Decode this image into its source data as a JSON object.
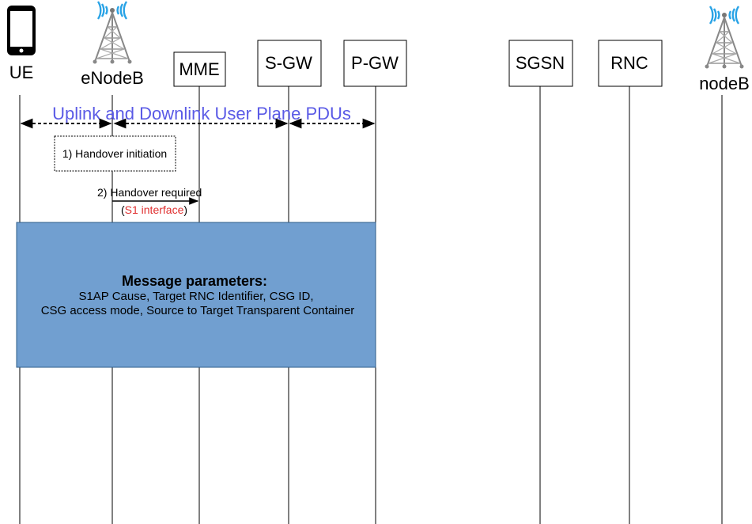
{
  "entities": {
    "ue": "UE",
    "enodeb": "eNodeB",
    "mme": "MME",
    "sgw": "S-GW",
    "pgw": "P-GW",
    "sgsn": "SGSN",
    "rnc": "RNC",
    "nodeb": "nodeB"
  },
  "banner": {
    "text": "Uplink and Downlink User Plane PDUs",
    "color": "#5a5ae6"
  },
  "steps": {
    "handover_initiation": "1) Handover initiation",
    "handover_required": "2) Handover required",
    "interface_open": "(",
    "interface_name": "S1 interface",
    "interface_close": ")",
    "interface_color": "#e03030"
  },
  "params": {
    "title": "Message parameters:",
    "line1": "S1AP Cause, Target RNC Identifier, CSG ID,",
    "line2": "CSG access mode, Source to Target Transparent Container",
    "fill": "#719fd0"
  },
  "icons": {
    "ue": "mobile-phone-icon",
    "enodeb": "cell-tower-icon",
    "nodeb": "cell-tower-icon"
  },
  "colors": {
    "wave": "#29a3e6",
    "line": "#000000"
  }
}
